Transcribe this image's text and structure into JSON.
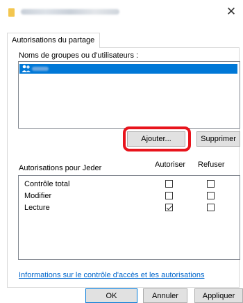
{
  "window": {
    "title_blurred": true,
    "close_glyph": "✕",
    "accent_color": "#0078d7"
  },
  "tabs": [
    {
      "label": "Autorisations du partage",
      "selected": true
    }
  ],
  "groups": {
    "heading": "Noms de groupes ou d'utilisateurs :",
    "items": [
      {
        "icon": "users-icon",
        "name_blurred": true,
        "selected": true
      }
    ]
  },
  "buttons": {
    "add": "Ajouter...",
    "remove": "Supprimer",
    "ok": "OK",
    "cancel": "Annuler",
    "apply": "Appliquer"
  },
  "permissions": {
    "heading": "Autorisations pour Jeder",
    "col_allow": "Autoriser",
    "col_deny": "Refuser",
    "rows": [
      {
        "label": "Contrôle total",
        "allow": false,
        "deny": false
      },
      {
        "label": "Modifier",
        "allow": false,
        "deny": false
      },
      {
        "label": "Lecture",
        "allow": true,
        "deny": false
      }
    ]
  },
  "help_link": "Informations sur le contrôle d'accès et les autorisations",
  "highlight_color": "#e8141c"
}
